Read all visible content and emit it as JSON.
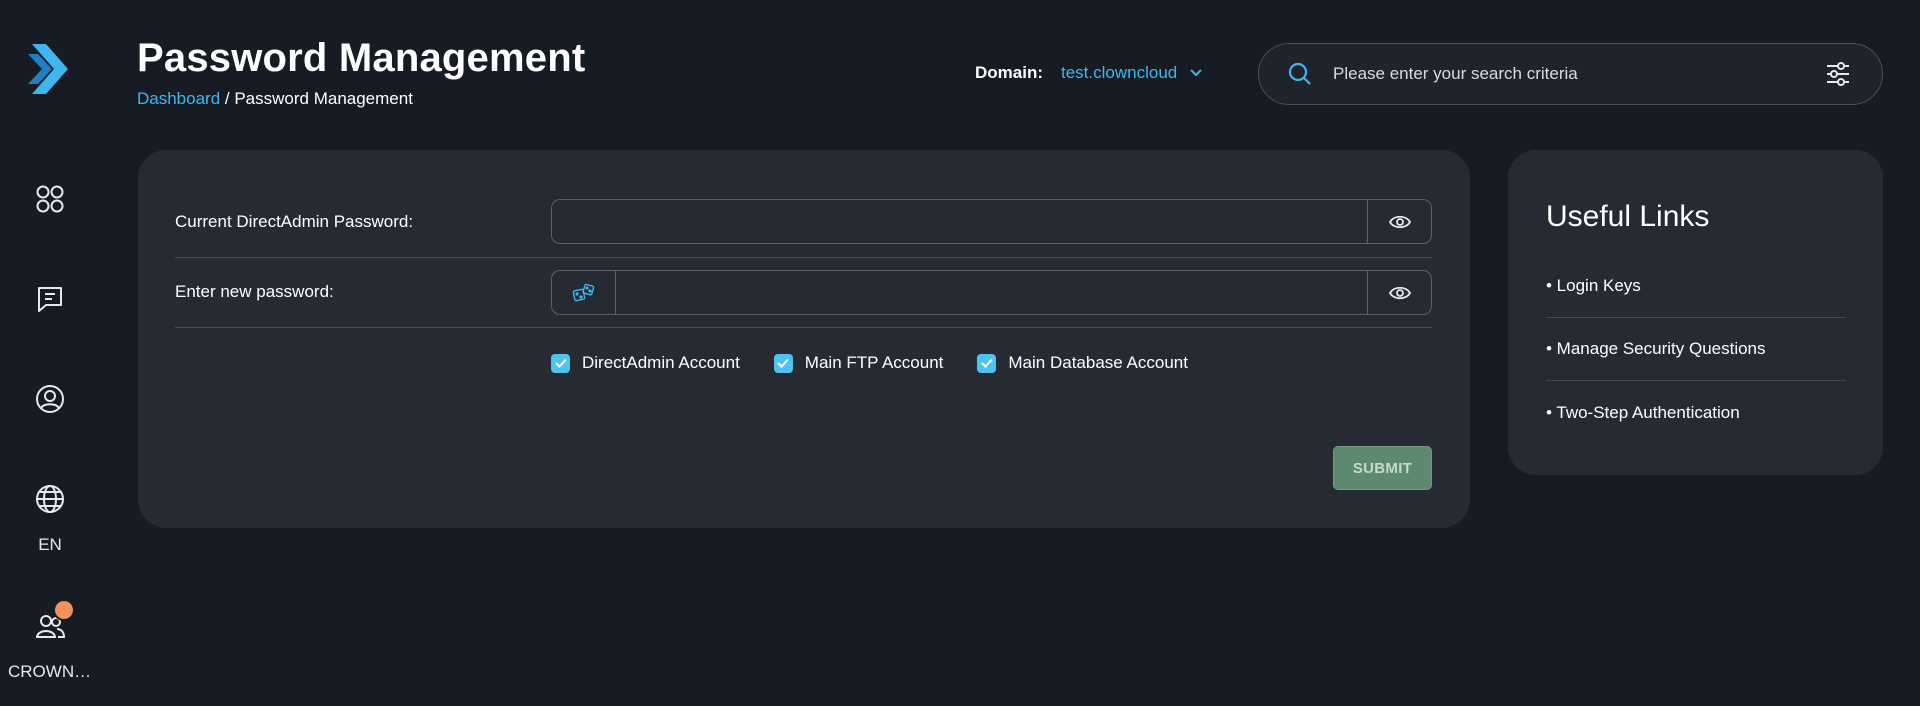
{
  "header": {
    "title": "Password Management",
    "breadcrumb": {
      "link": "Dashboard",
      "separator": " / ",
      "current": "Password Management"
    },
    "domain_label": "Domain:",
    "domain_value": "test.clowncloud",
    "search_placeholder": "Please enter your search criteria"
  },
  "sidebar": {
    "language": "EN",
    "user": "CROWNCLOUD",
    "icons": [
      "logo-icon",
      "apps-icon",
      "chat-icon",
      "user-icon",
      "globe-icon",
      "users-icon"
    ]
  },
  "form": {
    "current_password_label": "Current DirectAdmin Password:",
    "new_password_label": "Enter new password:",
    "checkboxes": [
      {
        "label": "DirectAdmin Account",
        "checked": true
      },
      {
        "label": "Main FTP Account",
        "checked": true
      },
      {
        "label": "Main Database Account",
        "checked": true
      }
    ],
    "submit_label": "SUBMIT"
  },
  "useful_links": {
    "title": "Useful Links",
    "items": [
      "• Login Keys",
      "• Manage Security Questions",
      "• Two-Step Authentication"
    ]
  },
  "colors": {
    "background": "#161b24",
    "card": "#252a33",
    "accent": "#3fb6f0",
    "submit": "#5d8a6c",
    "notification": "#f0945c"
  }
}
